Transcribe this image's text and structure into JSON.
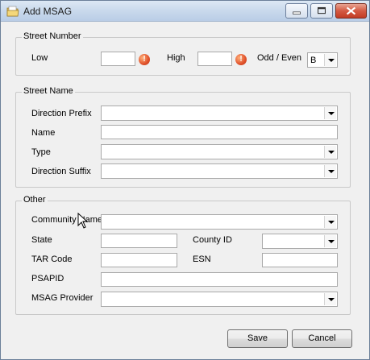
{
  "window": {
    "title": "Add MSAG"
  },
  "street_number": {
    "group_title": "Street Number",
    "low_label": "Low",
    "low_value": "",
    "high_label": "High",
    "high_value": "",
    "odd_even_label": "Odd / Even",
    "odd_even_value": "B"
  },
  "street_name": {
    "group_title": "Street Name",
    "direction_prefix_label": "Direction Prefix",
    "direction_prefix_value": "",
    "name_label": "Name",
    "name_value": "",
    "type_label": "Type",
    "type_value": "",
    "direction_suffix_label": "Direction Suffix",
    "direction_suffix_value": ""
  },
  "other": {
    "group_title": "Other",
    "community_name_label": "Community Name",
    "community_name_value": "",
    "state_label": "State",
    "state_value": "",
    "county_id_label": "County ID",
    "county_id_value": "",
    "tar_code_label": "TAR Code",
    "tar_code_value": "",
    "esn_label": "ESN",
    "esn_value": "",
    "psapid_label": "PSAPID",
    "psapid_value": "",
    "msag_provider_label": "MSAG Provider",
    "msag_provider_value": ""
  },
  "buttons": {
    "save": "Save",
    "cancel": "Cancel"
  },
  "icons": {
    "window_icon": "folder-icon",
    "required_icon": "exclamation-icon",
    "cursor": "mouse-pointer-icon"
  }
}
